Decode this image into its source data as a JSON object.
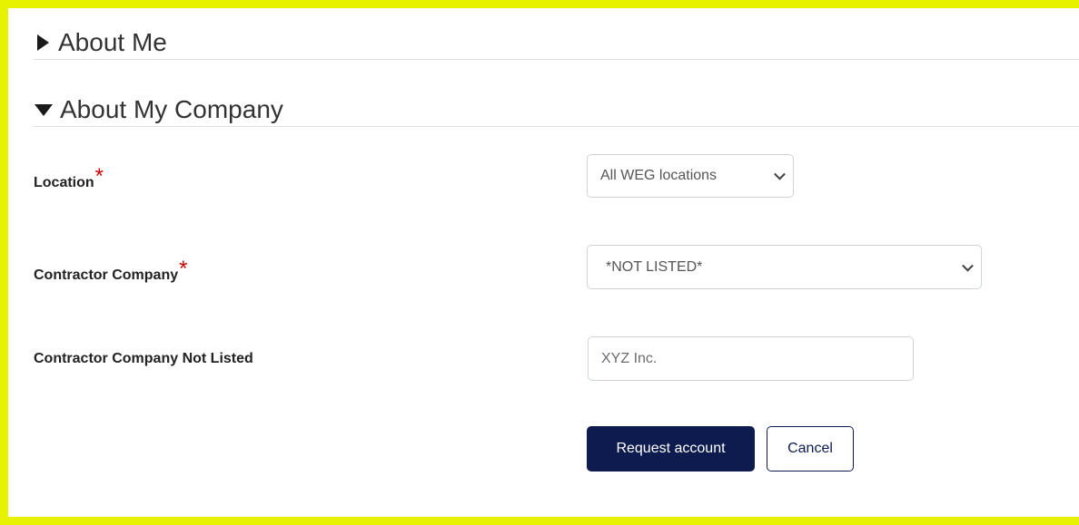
{
  "sections": {
    "about_me": {
      "title": "About Me",
      "expanded": false,
      "icon": "caret-right-icon"
    },
    "about_company": {
      "title": "About My Company",
      "expanded": true,
      "icon": "caret-down-icon"
    }
  },
  "form": {
    "location": {
      "label": "Location",
      "required_mark": "*",
      "selected": "All WEG locations"
    },
    "contractor_company": {
      "label": "Contractor Company",
      "required_mark": "*",
      "selected": "*NOT LISTED*"
    },
    "contractor_not_listed": {
      "label": "Contractor Company Not Listed",
      "value": "",
      "placeholder": "XYZ Inc."
    }
  },
  "actions": {
    "request_label": "Request account",
    "cancel_label": "Cancel"
  },
  "colors": {
    "frame": "#e7f200",
    "primary": "#0d1b4f",
    "required": "#d00000"
  }
}
